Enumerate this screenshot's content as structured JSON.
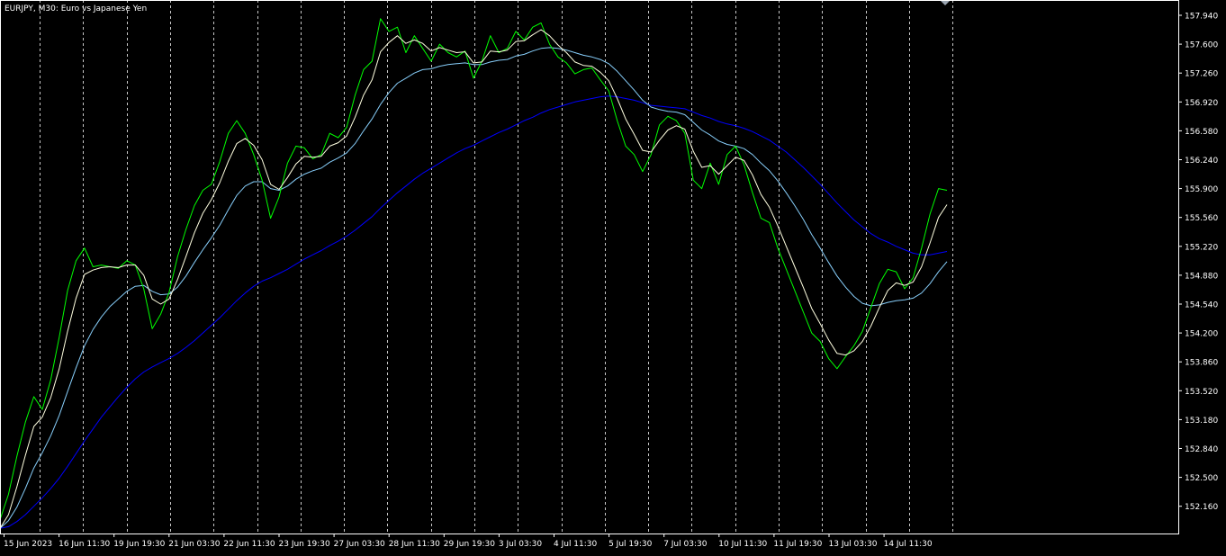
{
  "window": {
    "title": "EURJPY, M30:  Euro vs Japanese Yen"
  },
  "chart_data": {
    "type": "line",
    "symbol": "EURJPY",
    "timeframe": "M30",
    "description": "Euro vs Japanese Yen",
    "colors": {
      "background": "#000000",
      "price": "#00ff00",
      "ma_fast": "#ffffe0",
      "ma_mid": "#87cefa",
      "ma_slow": "#0000ff",
      "grid": "#c8c8c8",
      "text": "#ffffff"
    },
    "grid": true,
    "ylim": [
      151.9,
      158.0
    ],
    "y_ticks": [
      "157.940",
      "157.600",
      "157.260",
      "156.920",
      "156.580",
      "156.240",
      "155.900",
      "155.560",
      "155.220",
      "154.880",
      "154.540",
      "154.200",
      "153.860",
      "153.520",
      "153.180",
      "152.840",
      "152.500",
      "152.160"
    ],
    "x_ticks": [
      "15 Jun 2023",
      "16 Jun 11:30",
      "19 Jun 19:30",
      "21 Jun 03:30",
      "22 Jun 11:30",
      "23 Jun 19:30",
      "27 Jun 03:30",
      "28 Jun 11:30",
      "29 Jun 19:30",
      "3 Jul 03:30",
      "4 Jul 11:30",
      "5 Jul 19:30",
      "7 Jul 03:30",
      "10 Jul 11:30",
      "11 Jul 19:30",
      "13 Jul 03:30",
      "14 Jul 11:30"
    ],
    "series": [
      {
        "role": "price",
        "values": [
          152.0,
          152.3,
          152.75,
          153.15,
          153.45,
          153.3,
          153.65,
          154.15,
          154.7,
          155.05,
          155.2,
          154.98,
          155.0,
          154.98,
          154.96,
          155.05,
          155.0,
          154.72,
          154.25,
          154.42,
          154.68,
          155.1,
          155.42,
          155.7,
          155.88,
          155.95,
          156.22,
          156.55,
          156.7,
          156.55,
          156.3,
          156.0,
          155.55,
          155.8,
          156.2,
          156.4,
          156.38,
          156.25,
          156.3,
          156.55,
          156.5,
          156.62,
          157.0,
          157.3,
          157.4,
          157.9,
          157.75,
          157.8,
          157.5,
          157.7,
          157.55,
          157.4,
          157.6,
          157.5,
          157.45,
          157.52,
          157.2,
          157.4,
          157.7,
          157.5,
          157.55,
          157.75,
          157.65,
          157.8,
          157.85,
          157.6,
          157.45,
          157.38,
          157.25,
          157.3,
          157.32,
          157.18,
          157.05,
          156.7,
          156.4,
          156.3,
          156.1,
          156.3,
          156.65,
          156.75,
          156.7,
          156.55,
          156.0,
          155.9,
          156.2,
          155.95,
          156.3,
          156.4,
          156.18,
          155.85,
          155.55,
          155.5,
          155.2,
          154.95,
          154.7,
          154.45,
          154.2,
          154.1,
          153.9,
          153.78,
          153.92,
          154.05,
          154.22,
          154.5,
          154.78,
          154.95,
          154.92,
          154.72,
          154.85,
          155.2,
          155.6,
          155.9,
          155.88
        ]
      },
      {
        "role": "ma_fast",
        "values": [
          151.9,
          152.06,
          152.39,
          152.76,
          153.1,
          153.21,
          153.44,
          153.78,
          154.22,
          154.61,
          154.89,
          154.94,
          154.97,
          154.98,
          154.97,
          155.0,
          155.0,
          154.88,
          154.6,
          154.54,
          154.6,
          154.83,
          155.1,
          155.38,
          155.61,
          155.77,
          155.97,
          156.22,
          156.43,
          156.49,
          156.41,
          156.24,
          155.95,
          155.89,
          156.03,
          156.19,
          156.28,
          156.27,
          156.28,
          156.4,
          156.44,
          156.52,
          156.74,
          157.0,
          157.18,
          157.51,
          157.62,
          157.7,
          157.61,
          157.65,
          157.61,
          157.52,
          157.56,
          157.53,
          157.5,
          157.51,
          157.38,
          157.39,
          157.52,
          157.51,
          157.53,
          157.63,
          157.64,
          157.71,
          157.77,
          157.7,
          157.59,
          157.5,
          157.39,
          157.35,
          157.34,
          157.27,
          157.17,
          156.96,
          156.72,
          156.54,
          156.35,
          156.33,
          156.47,
          156.59,
          156.64,
          156.6,
          156.34,
          156.15,
          156.17,
          156.07,
          156.17,
          156.27,
          156.23,
          156.06,
          155.83,
          155.68,
          155.46,
          155.22,
          154.98,
          154.74,
          154.49,
          154.31,
          154.12,
          153.96,
          153.94,
          153.99,
          154.1,
          154.28,
          154.5,
          154.7,
          154.79,
          154.76,
          154.8,
          154.98,
          155.26,
          155.56,
          155.71
        ]
      },
      {
        "role": "ma_mid",
        "values": [
          151.9,
          151.99,
          152.15,
          152.37,
          152.61,
          152.79,
          152.99,
          153.23,
          153.51,
          153.79,
          154.05,
          154.24,
          154.39,
          154.51,
          154.6,
          154.69,
          154.75,
          154.76,
          154.69,
          154.65,
          154.66,
          154.74,
          154.87,
          155.03,
          155.18,
          155.32,
          155.47,
          155.65,
          155.82,
          155.93,
          155.98,
          155.98,
          155.9,
          155.88,
          155.93,
          156.01,
          156.07,
          156.11,
          156.14,
          156.21,
          156.26,
          156.32,
          156.43,
          156.58,
          156.72,
          156.89,
          157.03,
          157.14,
          157.2,
          157.26,
          157.3,
          157.31,
          157.34,
          157.36,
          157.37,
          157.38,
          157.36,
          157.36,
          157.39,
          157.41,
          157.42,
          157.46,
          157.48,
          157.52,
          157.55,
          157.56,
          157.55,
          157.53,
          157.5,
          157.47,
          157.45,
          157.42,
          157.37,
          157.28,
          157.17,
          157.06,
          156.94,
          156.86,
          156.83,
          156.81,
          156.8,
          156.77,
          156.68,
          156.59,
          156.53,
          156.46,
          156.42,
          156.4,
          156.37,
          156.3,
          156.2,
          156.11,
          155.99,
          155.85,
          155.7,
          155.54,
          155.36,
          155.2,
          155.03,
          154.87,
          154.74,
          154.63,
          154.55,
          154.52,
          154.53,
          154.56,
          154.58,
          154.59,
          154.61,
          154.67,
          154.78,
          154.92,
          155.04
        ]
      },
      {
        "role": "ma_slow",
        "values": [
          151.9,
          151.92,
          151.98,
          152.06,
          152.16,
          152.26,
          152.37,
          152.49,
          152.63,
          152.78,
          152.93,
          153.07,
          153.21,
          153.33,
          153.45,
          153.56,
          153.66,
          153.74,
          153.8,
          153.85,
          153.9,
          153.96,
          154.03,
          154.11,
          154.2,
          154.29,
          154.38,
          154.48,
          154.58,
          154.67,
          154.75,
          154.81,
          154.85,
          154.9,
          154.95,
          155.01,
          155.07,
          155.12,
          155.17,
          155.23,
          155.28,
          155.34,
          155.41,
          155.49,
          155.57,
          155.67,
          155.76,
          155.85,
          155.93,
          156.01,
          156.08,
          156.14,
          156.2,
          156.26,
          156.32,
          156.37,
          156.41,
          156.46,
          156.51,
          156.56,
          156.6,
          156.65,
          156.7,
          156.74,
          156.79,
          156.83,
          156.86,
          156.89,
          156.92,
          156.94,
          156.96,
          156.98,
          156.99,
          156.98,
          156.96,
          156.94,
          156.91,
          156.88,
          156.87,
          156.86,
          156.85,
          156.84,
          156.8,
          156.76,
          156.73,
          156.69,
          156.66,
          156.64,
          156.61,
          156.57,
          156.52,
          156.47,
          156.4,
          156.33,
          156.24,
          156.15,
          156.05,
          155.95,
          155.84,
          155.73,
          155.63,
          155.53,
          155.45,
          155.37,
          155.31,
          155.27,
          155.22,
          155.18,
          155.14,
          155.12,
          155.12,
          155.14,
          155.16
        ]
      }
    ]
  }
}
